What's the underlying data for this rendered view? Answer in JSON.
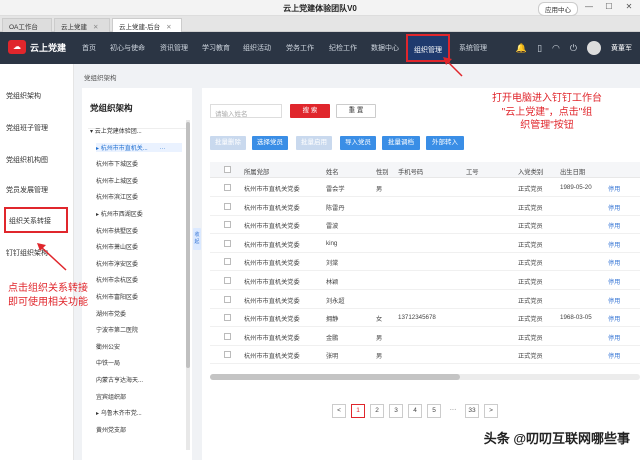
{
  "browser": {
    "title": "云上党建体验团队V0",
    "app_center": "应用中心",
    "tabs": [
      {
        "label": "OA工作台"
      },
      {
        "label": "云上党建"
      },
      {
        "label": "云上党建-后台",
        "active": true
      }
    ]
  },
  "topnav": {
    "logo": "云上党建",
    "items": [
      "首页",
      "初心与使命",
      "资讯管理",
      "学习教育",
      "组织活动",
      "党务工作",
      "纪检工作",
      "数据中心",
      "组织管理",
      "系统管理"
    ],
    "active": "组织管理",
    "user": "黄董军"
  },
  "leftnav": {
    "items": [
      "党组织架构",
      "党组班子管理",
      "党组织机构图",
      "党员发展管理",
      "组织关系转接",
      "钉钉组织架构"
    ],
    "highlighted": "组织关系转接"
  },
  "breadcrumb": "党组织架构",
  "tree": {
    "title": "党组织架构",
    "nodes": [
      {
        "label": "云上党建体验团...",
        "level": 0,
        "expanded": true
      },
      {
        "label": "杭州市市直机关...",
        "level": 1,
        "selected": true,
        "expanded": false
      },
      {
        "label": "杭州市下城区委",
        "level": 1
      },
      {
        "label": "杭州市上城区委",
        "level": 1
      },
      {
        "label": "杭州市滨江区委",
        "level": 1
      },
      {
        "label": "杭州市西湖区委",
        "level": 1,
        "expanded": false
      },
      {
        "label": "杭州市拱墅区委",
        "level": 1
      },
      {
        "label": "杭州市萧山区委",
        "level": 1
      },
      {
        "label": "杭州市淳安区委",
        "level": 1
      },
      {
        "label": "杭州市余杭区委",
        "level": 1
      },
      {
        "label": "杭州市富阳区委",
        "level": 1
      },
      {
        "label": "湖州市党委",
        "level": 1
      },
      {
        "label": "宁波市第二医院",
        "level": 1
      },
      {
        "label": "衢州公安",
        "level": 1
      },
      {
        "label": "中铁一局",
        "level": 1
      },
      {
        "label": "内蒙古亨达海天...",
        "level": 1
      },
      {
        "label": "宜宾组织部",
        "level": 1
      },
      {
        "label": "乌鲁木齐市党...",
        "level": 1,
        "expanded": false
      },
      {
        "label": "黄州党支部",
        "level": 1
      }
    ],
    "collapse_label": "收起"
  },
  "search": {
    "placeholder": "请输入姓名",
    "search_label": "搜 索",
    "reset_label": "重 置"
  },
  "toolbar": [
    "批量删除",
    "选择党员",
    "批量启用",
    "导入党员",
    "批量调档",
    "外部转入"
  ],
  "table": {
    "columns": [
      "",
      "所属党部",
      "姓名",
      "性别",
      "手机号码",
      "工号",
      "入党类别",
      "出生日期"
    ],
    "rows": [
      {
        "party": "杭州市市直机关党委",
        "name": "雷会学",
        "gender": "男",
        "phone": "",
        "job": "",
        "type": "正式党员",
        "birth": "1989-05-20",
        "op": "停用"
      },
      {
        "party": "杭州市市直机关党委",
        "name": "陈雷丹",
        "gender": "",
        "phone": "",
        "job": "",
        "type": "正式党员",
        "birth": "",
        "op": "停用"
      },
      {
        "party": "杭州市市直机关党委",
        "name": "雷波",
        "gender": "",
        "phone": "",
        "job": "",
        "type": "正式党员",
        "birth": "",
        "op": "停用"
      },
      {
        "party": "杭州市市直机关党委",
        "name": "king",
        "gender": "",
        "phone": "",
        "job": "",
        "type": "正式党员",
        "birth": "",
        "op": "停用"
      },
      {
        "party": "杭州市市直机关党委",
        "name": "刘棠",
        "gender": "",
        "phone": "",
        "job": "",
        "type": "正式党员",
        "birth": "",
        "op": "停用"
      },
      {
        "party": "杭州市市直机关党委",
        "name": "林颖",
        "gender": "",
        "phone": "",
        "job": "",
        "type": "正式党员",
        "birth": "",
        "op": "停用"
      },
      {
        "party": "杭州市市直机关党委",
        "name": "刘永超",
        "gender": "",
        "phone": "",
        "job": "",
        "type": "正式党员",
        "birth": "",
        "op": "停用"
      },
      {
        "party": "杭州市市直机关党委",
        "name": "拥静",
        "gender": "女",
        "phone": "13712345678",
        "job": "",
        "type": "正式党员",
        "birth": "1968-03-05",
        "op": "停用"
      },
      {
        "party": "杭州市市直机关党委",
        "name": "金鹏",
        "gender": "男",
        "phone": "",
        "job": "",
        "type": "正式党员",
        "birth": "",
        "op": "停用"
      },
      {
        "party": "杭州市市直机关党委",
        "name": "张明",
        "gender": "男",
        "phone": "",
        "job": "",
        "type": "正式党员",
        "birth": "",
        "op": "停用"
      }
    ]
  },
  "pagination": {
    "prev": "<",
    "pages": [
      "1",
      "2",
      "3",
      "4",
      "5"
    ],
    "ellipsis": "···",
    "last": "33",
    "next": ">",
    "current": "1"
  },
  "annotations": {
    "top": "打开电脑进入钉钉工作台\n\"云上党建\"，点击\"组\n织管理\"按钮",
    "left": "点击组织关系转接\n即可使用相关功能"
  },
  "watermark": "头条 @叨叨互联网哪些事",
  "colors": {
    "accent": "#e0262c",
    "nav_bg": "#2b3544",
    "primary": "#3a8ee6"
  }
}
